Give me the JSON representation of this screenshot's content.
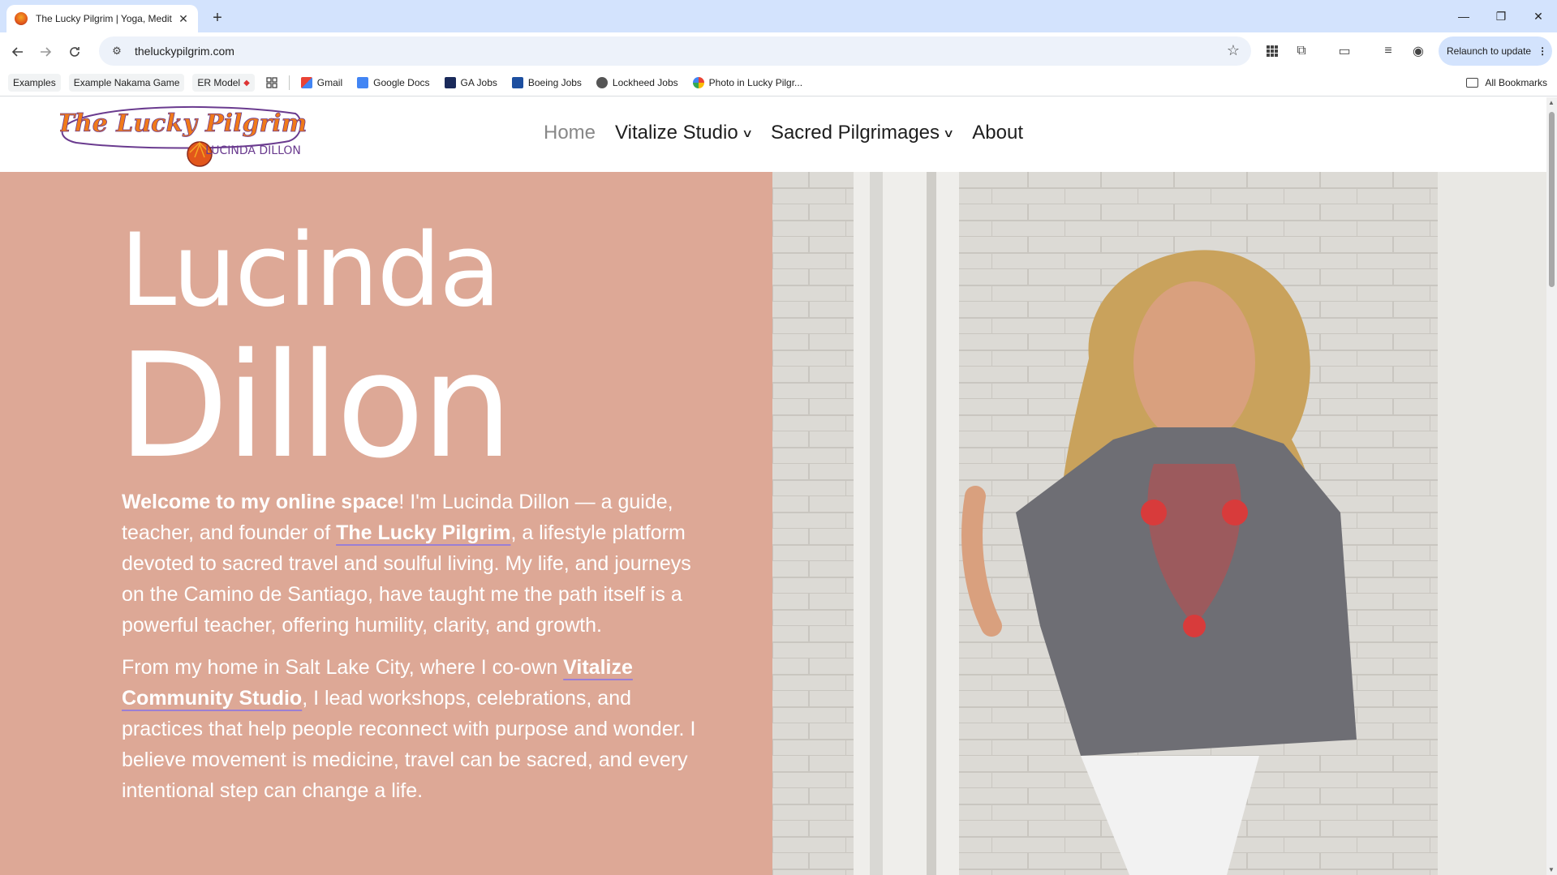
{
  "browser": {
    "tab_title": "The Lucky Pilgrim | Yoga, Medit",
    "url": "theluckypilgrim.com",
    "relaunch_label": "Relaunch to update",
    "bookmarks": [
      {
        "label": "Examples",
        "style": "chip"
      },
      {
        "label": "Example Nakama Game",
        "style": "chip"
      },
      {
        "label": "ER Model",
        "style": "chip"
      },
      {
        "label": "Gmail",
        "icon": "gmail-icon"
      },
      {
        "label": "Google Docs",
        "icon": "google-docs-icon"
      },
      {
        "label": "GA Jobs",
        "icon": "ga-jobs-icon"
      },
      {
        "label": "Boeing Jobs",
        "icon": "boeing-icon"
      },
      {
        "label": "Lockheed Jobs",
        "icon": "lockheed-icon"
      },
      {
        "label": "Photo in Lucky Pilgr...",
        "icon": "photos-icon"
      }
    ],
    "all_bookmarks_label": "All Bookmarks"
  },
  "site": {
    "logo_title": "The Lucky Pilgrim",
    "logo_subtitle": "LUCINDA DILLON",
    "nav": {
      "home": "Home",
      "vitalize": "Vitalize Studio",
      "pilgrimages": "Sacred Pilgrimages",
      "about": "About"
    },
    "hero": {
      "first_name": "Lucinda",
      "last_name": "Dillon",
      "p1_bold": "Welcome to my online space",
      "p1_a": "! I'm Lucinda Dillon — a guide, teacher, and founder of ",
      "p1_link": "The Lucky Pilgrim",
      "p1_b": ", a lifestyle platform devoted to sacred travel and soulful living. My life, and journeys on the Camino de Santiago, have taught me the path itself is a powerful teacher, offering humility, clarity, and growth.",
      "p2_a": "From my home in Salt Lake City, where I co-own ",
      "p2_link": "Vitalize Community Studio",
      "p2_b": ", I lead workshops, celebrations, and practices that help people reconnect with purpose and wonder. I believe movement is medicine, travel can be sacred, and every intentional step can change a life."
    },
    "colors": {
      "hero_bg": "#dda896",
      "link_underline": "#9b7fd4",
      "logo_orange": "#f07a1a",
      "logo_purple": "#6a3b8f"
    }
  }
}
